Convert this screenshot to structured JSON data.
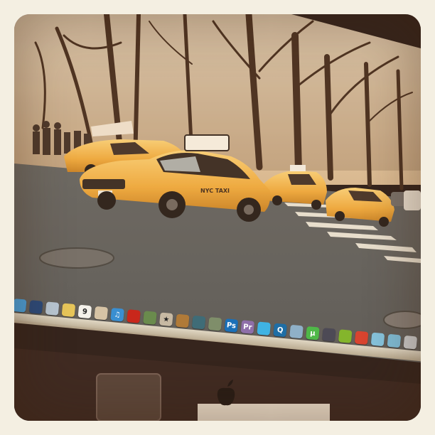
{
  "scene": {
    "photo_tint": "#e7b67a",
    "sky_color": "#f3e3c8",
    "road_color": "#56585a",
    "taxi_color": "#f0b23a",
    "bezel_color": "#1e1210"
  },
  "taxi": {
    "door_logo": "NYC TAXI",
    "sign_text": ""
  },
  "dock": {
    "icons": [
      {
        "name": "finder-icon",
        "color": "#4a9fd8",
        "glyph": ""
      },
      {
        "name": "dashboard-icon",
        "color": "#2c4a7a",
        "glyph": ""
      },
      {
        "name": "mail-icon",
        "color": "#b9c7d3",
        "glyph": ""
      },
      {
        "name": "notes-icon",
        "color": "#e8c65a",
        "glyph": ""
      },
      {
        "name": "calendar-icon",
        "color": "#f4f1ea",
        "glyph": "9"
      },
      {
        "name": "preview-icon",
        "color": "#d6c3a5",
        "glyph": ""
      },
      {
        "name": "itunes-icon",
        "color": "#3a8fd1",
        "glyph": "♫"
      },
      {
        "name": "photo-booth-icon",
        "color": "#c9271b",
        "glyph": ""
      },
      {
        "name": "iphoto-icon",
        "color": "#6a8b4d",
        "glyph": ""
      },
      {
        "name": "imovie-icon",
        "color": "#c7b9a3",
        "glyph": "★"
      },
      {
        "name": "garageband-icon",
        "color": "#b07a38",
        "glyph": ""
      },
      {
        "name": "time-machine-icon",
        "color": "#3f6c77",
        "glyph": ""
      },
      {
        "name": "facetime-icon",
        "color": "#7f8e6a",
        "glyph": ""
      },
      {
        "name": "photoshop-icon",
        "color": "#1b70b8",
        "glyph": "Ps"
      },
      {
        "name": "premiere-icon",
        "color": "#8e6fa9",
        "glyph": "Pr"
      },
      {
        "name": "twitter-icon",
        "color": "#3fb3e3",
        "glyph": ""
      },
      {
        "name": "quicktime-icon",
        "color": "#1f6ea5",
        "glyph": "Q"
      },
      {
        "name": "xcode-icon",
        "color": "#8fb0c7",
        "glyph": ""
      },
      {
        "name": "utorrent-icon",
        "color": "#4fb848",
        "glyph": "µ"
      },
      {
        "name": "textmate-icon",
        "color": "#4d4a55",
        "glyph": ""
      },
      {
        "name": "spotify-icon",
        "color": "#84b52c",
        "glyph": ""
      },
      {
        "name": "chrome-icon",
        "color": "#d9442f",
        "glyph": ""
      },
      {
        "name": "folder-icon",
        "color": "#86c3dc",
        "glyph": ""
      },
      {
        "name": "downloads-icon",
        "color": "#7fbcd6",
        "glyph": ""
      },
      {
        "name": "trash-icon",
        "color": "#c9c9c9",
        "glyph": ""
      }
    ]
  }
}
